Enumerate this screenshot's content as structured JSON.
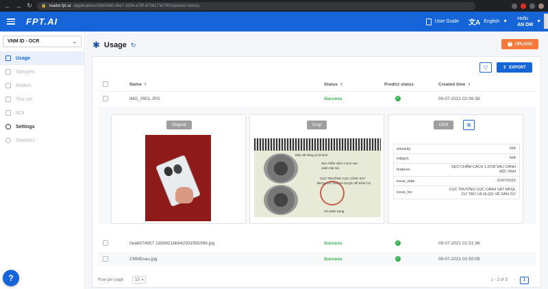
{
  "browser": {
    "url_host": "reader.fpt.ai",
    "url_path": "/applications/33b05d0-06e7-4204-a78f-6728173d7902/predict-history"
  },
  "header": {
    "logo": "FPT.AI",
    "user_guide": "User Guide",
    "language": "English",
    "greeting": "Hello",
    "username": "AN DM"
  },
  "sidebar": {
    "project": "VNM ID - OCR",
    "items": [
      {
        "label": "Usage",
        "state": "active"
      },
      {
        "label": "Samples",
        "state": "disabled"
      },
      {
        "label": "Models",
        "state": "disabled"
      },
      {
        "label": "Test set",
        "state": "disabled"
      },
      {
        "label": "ROI",
        "state": "disabled"
      },
      {
        "label": "Settings",
        "state": "normal"
      },
      {
        "label": "Statistics",
        "state": "disabled"
      }
    ],
    "help": "?"
  },
  "page": {
    "title": "Usage",
    "upload_label": "UPLOAD",
    "export_label": "EXPORT"
  },
  "table": {
    "columns": {
      "name": "Name",
      "status": "Status",
      "predict_status": "Predict status",
      "created_time": "Created time"
    },
    "rows": [
      {
        "name": "IMG_0501.JPG",
        "status": "Success",
        "created": "09-07-2021 02:06:38"
      },
      {
        "name": "0ea6074957 2d399218b842931f892f86.jpg",
        "status": "Success",
        "created": "09-07-2021 01:51:36"
      },
      {
        "name": "CMNDsau.jpg",
        "status": "Success",
        "created": "09-07-2021 01:50:09"
      }
    ]
  },
  "detail": {
    "original_label": "Original",
    "crop_label": "Crop",
    "ocr_label": "OCR",
    "crop_text": {
      "header": "Dấu vết riêng và dị hình",
      "line1": "Sẹo chấm cách 1.2cm sau",
      "line2": "cánh mũi trái",
      "line3": "CỤC TRƯỞNG CỤC CẢNH SÁT",
      "line4": "ĐKQL CƯ TRÚ VÀ DLQG VỀ DÂN CƯ",
      "signer": "Vũ Xuân Dung"
    },
    "ocr_fields": [
      {
        "key": "ethnicity",
        "value": "N/A"
      },
      {
        "key": "religion",
        "value": "N/A"
      },
      {
        "key": "features",
        "value": "SẸO CHẤM CÁCH 1.2CM SAU CÁNH MŨI TRÁI"
      },
      {
        "key": "issue_date",
        "value": "31/07/2015"
      },
      {
        "key": "issue_loc",
        "value": "CỤC TRƯỞNG CỤC CẢNH SÁT ĐKQL CƯ TRÚ VÀ DLQG VỀ DÂN CƯ"
      }
    ]
  },
  "footer": {
    "rows_per_page_label": "Row per page",
    "rows_per_page_value": "10",
    "range": "1 - 3 of 3",
    "page": "1"
  },
  "colors": {
    "primary": "#1565d8",
    "accent": "#f4793b",
    "success": "#2eb34a"
  }
}
